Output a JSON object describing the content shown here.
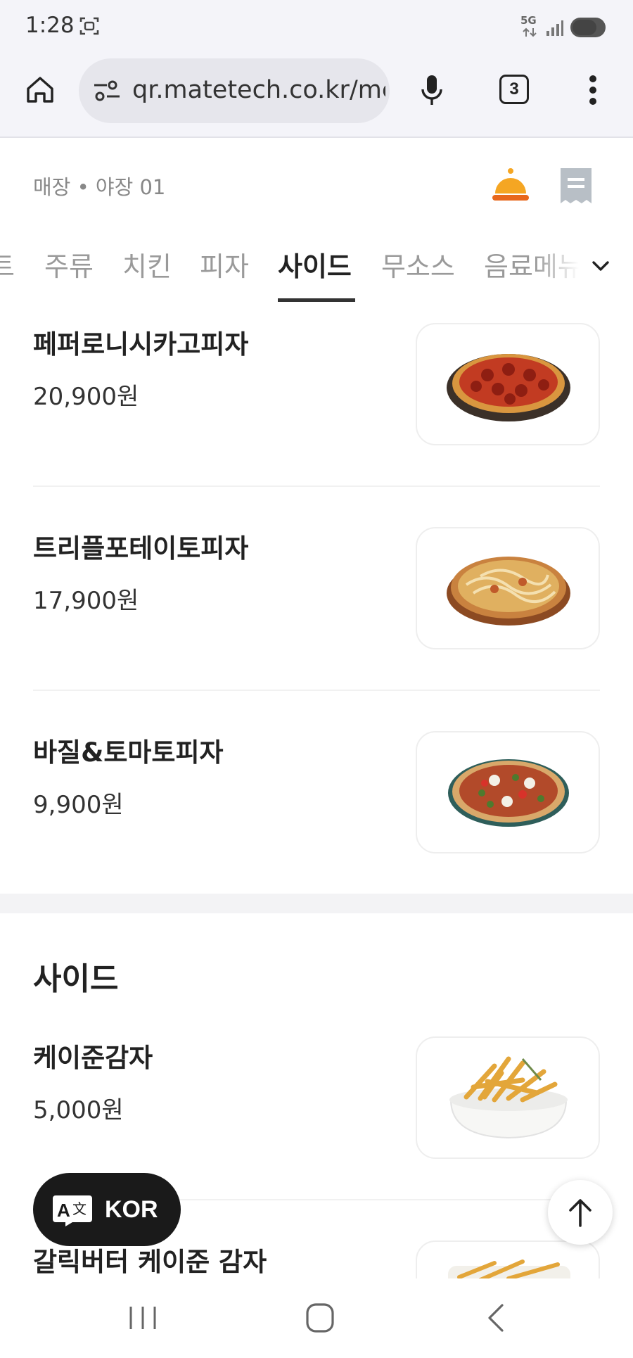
{
  "status": {
    "time": "1:28",
    "network": "5G"
  },
  "browser": {
    "url": "qr.matetech.co.kr/me",
    "tab_count": "3"
  },
  "store": {
    "label": "매장 • 야장 01"
  },
  "tabs": [
    {
      "label": "트"
    },
    {
      "label": "주류"
    },
    {
      "label": "치킨"
    },
    {
      "label": "피자"
    },
    {
      "label": "사이드"
    },
    {
      "label": "무소스"
    },
    {
      "label": "음료메뉴"
    }
  ],
  "active_tab": "사이드",
  "menu": {
    "items": [
      {
        "name": "페퍼로니시카고피자",
        "price": "20,900원",
        "image": "pepperoni-pizza"
      },
      {
        "name": "트리플포테이토피자",
        "price": "17,900원",
        "image": "potato-pizza"
      },
      {
        "name": "바질&토마토피자",
        "price": "9,900원",
        "image": "basil-tomato-pizza"
      }
    ],
    "side_section_title": "사이드",
    "side_items": [
      {
        "name": "케이준감자",
        "price": "5,000원",
        "image": "cajun-fries"
      },
      {
        "name": "갈릭버터 케이준 감자",
        "price": "",
        "image": "garlic-butter-fries"
      }
    ]
  },
  "floating": {
    "language": "KOR"
  },
  "icons": {
    "home": "home-icon",
    "site_settings": "site-settings-icon",
    "mic": "mic-icon",
    "tabs": "tab-switcher-icon",
    "more": "more-vert-icon",
    "bell": "bell-icon",
    "receipt": "receipt-icon",
    "chevron": "chevron-down-icon",
    "translate": "translate-icon",
    "arrow_up": "arrow-up-icon"
  },
  "colors": {
    "accent_bell": "#f5a623",
    "text_primary": "#222222",
    "text_muted": "#9a9a9a",
    "lang_button": "#1a1a1a"
  }
}
